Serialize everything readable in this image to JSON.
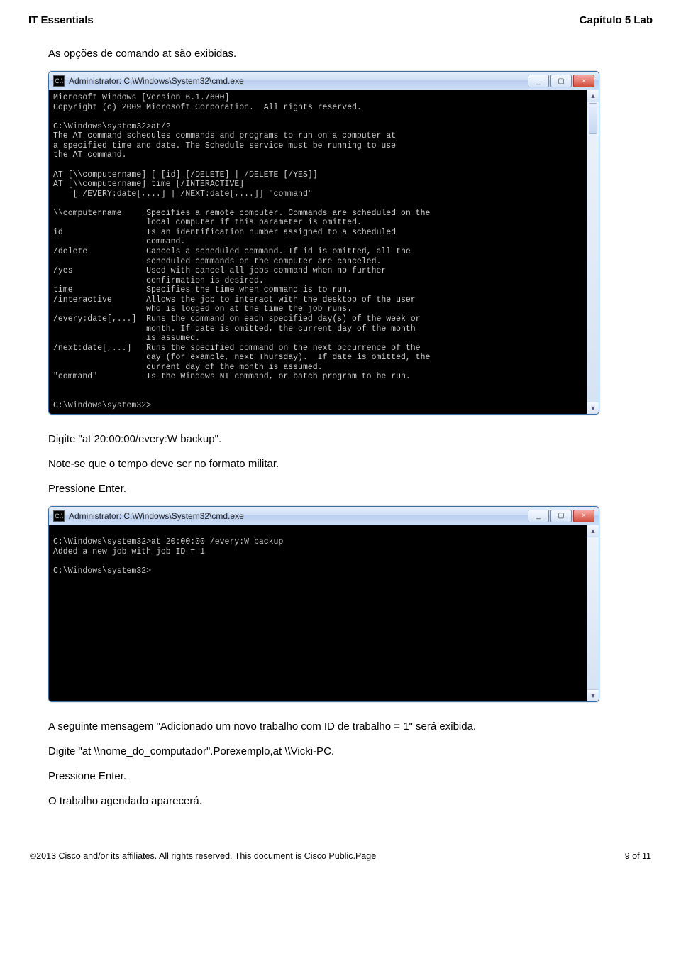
{
  "header": {
    "left": "IT Essentials",
    "right": "Capítulo 5 Lab"
  },
  "paragraphs": {
    "p1": "As opções de comando at são exibidas.",
    "p2": "Digite \"at 20:00:00/every:W backup\".",
    "p3": "Note-se que o tempo deve ser no formato militar.",
    "p4": "Pressione Enter.",
    "p5": "A seguinte mensagem \"Adicionado um novo trabalho com ID de trabalho = 1\" será exibida.",
    "p6": "Digite \"at \\\\nome_do_computador\".Porexemplo,at \\\\Vicki-PC.",
    "p7": "Pressione Enter.",
    "p8": "O trabalho agendado aparecerá."
  },
  "window": {
    "title": "Administrator: C:\\Windows\\System32\\cmd.exe",
    "min_label": "_",
    "max_label": "▢",
    "close_label": "×"
  },
  "cmd1": "Microsoft Windows [Version 6.1.7600]\nCopyright (c) 2009 Microsoft Corporation.  All rights reserved.\n\nC:\\Windows\\system32>at/?\nThe AT command schedules commands and programs to run on a computer at\na specified time and date. The Schedule service must be running to use\nthe AT command.\n\nAT [\\\\computername] [ [id] [/DELETE] | /DELETE [/YES]]\nAT [\\\\computername] time [/INTERACTIVE]\n    [ /EVERY:date[,...] | /NEXT:date[,...]] \"command\"\n\n\\\\computername     Specifies a remote computer. Commands are scheduled on the\n                   local computer if this parameter is omitted.\nid                 Is an identification number assigned to a scheduled\n                   command.\n/delete            Cancels a scheduled command. If id is omitted, all the\n                   scheduled commands on the computer are canceled.\n/yes               Used with cancel all jobs command when no further\n                   confirmation is desired.\ntime               Specifies the time when command is to run.\n/interactive       Allows the job to interact with the desktop of the user\n                   who is logged on at the time the job runs.\n/every:date[,...]  Runs the command on each specified day(s) of the week or\n                   month. If date is omitted, the current day of the month\n                   is assumed.\n/next:date[,...]   Runs the specified command on the next occurrence of the\n                   day (for example, next Thursday).  If date is omitted, the\n                   current day of the month is assumed.\n\"command\"          Is the Windows NT command, or batch program to be run.\n\n\nC:\\Windows\\system32>",
  "cmd2": "\nC:\\Windows\\system32>at 20:00:00 /every:W backup\nAdded a new job with job ID = 1\n\nC:\\Windows\\system32>",
  "footer": {
    "left": "©2013 Cisco and/or its affiliates. All rights reserved. This document is Cisco Public.Page",
    "right": "9 of 11"
  }
}
